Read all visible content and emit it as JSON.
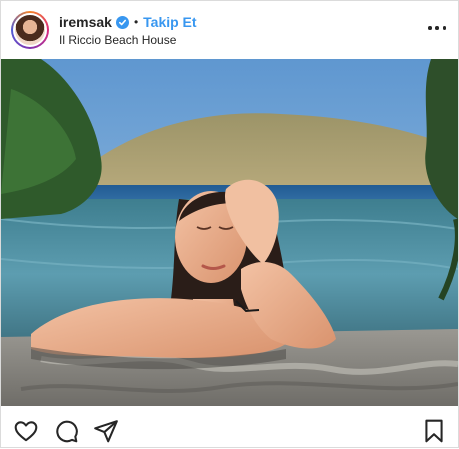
{
  "post": {
    "username": "iremsak",
    "separator": "•",
    "follow_label": "Takip Et",
    "location": "Il Riccio Beach House"
  },
  "icons": {
    "verified": "verified-badge-icon",
    "more": "more-options-icon",
    "like": "heart-icon",
    "comment": "comment-icon",
    "share": "share-icon",
    "save": "bookmark-icon"
  },
  "colors": {
    "accent": "#3897f0",
    "text": "#262626",
    "border": "#dbdbdb"
  }
}
